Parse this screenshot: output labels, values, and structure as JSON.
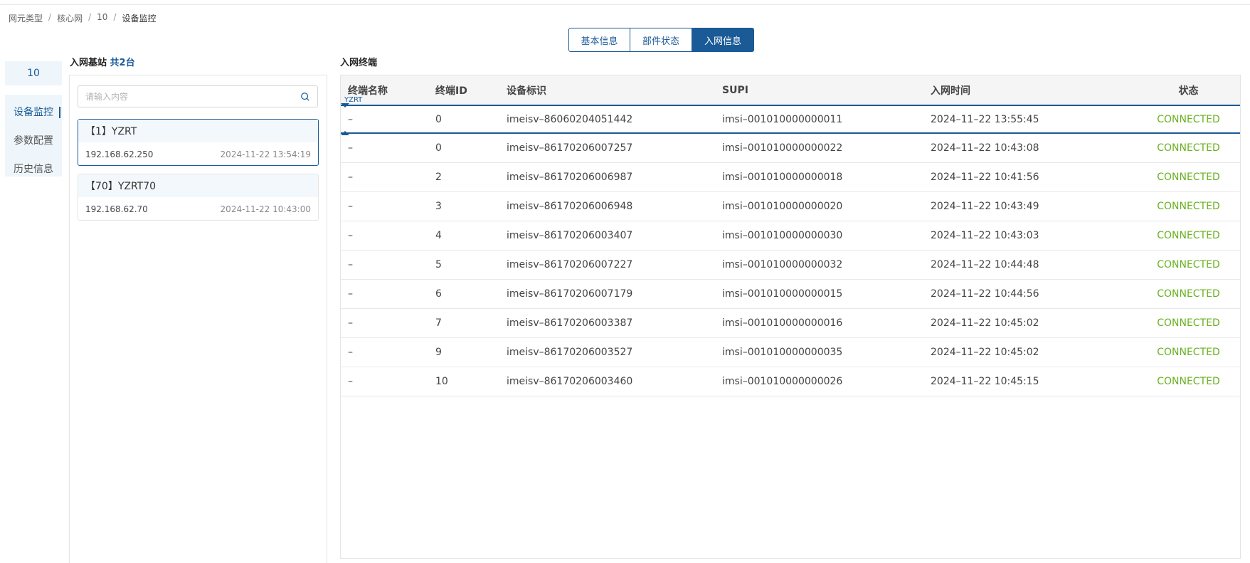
{
  "breadcrumb": [
    "网元类型",
    "核心网",
    "10",
    "设备监控"
  ],
  "tabs": [
    {
      "label": "基本信息",
      "active": false
    },
    {
      "label": "部件状态",
      "active": false
    },
    {
      "label": "入网信息",
      "active": true
    }
  ],
  "left_nav": {
    "top_label": "10",
    "items": [
      {
        "label": "设备监控",
        "active": true
      },
      {
        "label": "参数配置",
        "active": false
      },
      {
        "label": "历史信息",
        "active": false
      }
    ]
  },
  "stations": {
    "title": "入网基站",
    "count_label": "共2台",
    "search_placeholder": "请输入内容",
    "items": [
      {
        "name": "【1】YZRT",
        "ip": "192.168.62.250",
        "time": "2024-11-22 13:54:19",
        "selected": true
      },
      {
        "name": "【70】YZRT70",
        "ip": "192.168.62.70",
        "time": "2024-11-22 10:43:00",
        "selected": false
      }
    ]
  },
  "terminals": {
    "title": "入网终端",
    "selected_name_tag": "YZRT",
    "columns": [
      "终端名称",
      "终端ID",
      "设备标识",
      "SUPI",
      "入网时间",
      "状态"
    ],
    "rows": [
      {
        "name": "–",
        "id": "0",
        "imei": "imeisv–86060204051442",
        "supi": "imsi–001010000000011",
        "time": "2024–11–22 13:55:45",
        "status": "CONNECTED"
      },
      {
        "name": "–",
        "id": "0",
        "imei": "imeisv–86170206007257",
        "supi": "imsi–001010000000022",
        "time": "2024–11–22 10:43:08",
        "status": "CONNECTED"
      },
      {
        "name": "–",
        "id": "2",
        "imei": "imeisv–86170206006987",
        "supi": "imsi–001010000000018",
        "time": "2024–11–22 10:41:56",
        "status": "CONNECTED"
      },
      {
        "name": "–",
        "id": "3",
        "imei": "imeisv–86170206006948",
        "supi": "imsi–001010000000020",
        "time": "2024–11–22 10:43:49",
        "status": "CONNECTED"
      },
      {
        "name": "–",
        "id": "4",
        "imei": "imeisv–86170206003407",
        "supi": "imsi–001010000000030",
        "time": "2024–11–22 10:43:03",
        "status": "CONNECTED"
      },
      {
        "name": "–",
        "id": "5",
        "imei": "imeisv–86170206007227",
        "supi": "imsi–001010000000032",
        "time": "2024–11–22 10:44:48",
        "status": "CONNECTED"
      },
      {
        "name": "–",
        "id": "6",
        "imei": "imeisv–86170206007179",
        "supi": "imsi–001010000000015",
        "time": "2024–11–22 10:44:56",
        "status": "CONNECTED"
      },
      {
        "name": "–",
        "id": "7",
        "imei": "imeisv–86170206003387",
        "supi": "imsi–001010000000016",
        "time": "2024–11–22 10:45:02",
        "status": "CONNECTED"
      },
      {
        "name": "–",
        "id": "9",
        "imei": "imeisv–86170206003527",
        "supi": "imsi–001010000000035",
        "time": "2024–11–22 10:45:02",
        "status": "CONNECTED"
      },
      {
        "name": "–",
        "id": "10",
        "imei": "imeisv–86170206003460",
        "supi": "imsi–001010000000026",
        "time": "2024–11–22 10:45:15",
        "status": "CONNECTED"
      }
    ]
  },
  "colors": {
    "accent": "#1a5a96",
    "status_ok": "#6ab020"
  },
  "icons": {
    "search": "search-icon"
  }
}
